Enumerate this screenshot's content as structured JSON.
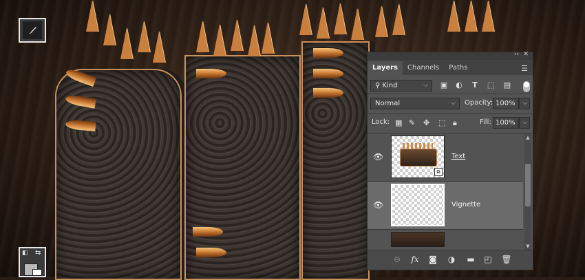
{
  "panel": {
    "title_controls": {
      "collapse": "‹‹",
      "close": "✕"
    },
    "tabs": [
      {
        "label": "Layers",
        "active": true
      },
      {
        "label": "Channels",
        "active": false
      },
      {
        "label": "Paths",
        "active": false
      }
    ],
    "menu_icon": "hamburger-icon",
    "filter": {
      "kind_label": "Kind",
      "icons": [
        "pixel-filter-icon",
        "adjustment-filter-icon",
        "type-filter-icon",
        "shape-filter-icon",
        "smart-object-filter-icon"
      ]
    },
    "blend_mode": "Normal",
    "opacity": {
      "label": "Opacity:",
      "value": "100%"
    },
    "lock": {
      "label": "Lock:",
      "icons": [
        "lock-transparent-icon",
        "lock-pixels-icon",
        "lock-position-icon",
        "lock-artboard-icon",
        "lock-all-icon"
      ]
    },
    "fill": {
      "label": "Fill:",
      "value": "100%"
    },
    "layers": [
      {
        "name": "Text",
        "visible": true,
        "selected": false,
        "smart_object": true
      },
      {
        "name": "Vignette",
        "visible": true,
        "selected": true,
        "smart_object": false
      },
      {
        "name": "",
        "visible": true,
        "selected": false,
        "smart_object": false
      }
    ],
    "footer_icons": [
      "link-layers-icon",
      "fx-icon",
      "add-mask-icon",
      "adjustment-layer-icon",
      "new-group-icon",
      "new-layer-icon",
      "delete-layer-icon"
    ]
  },
  "toolbox": {
    "active_tool": "brush-icon",
    "swap_colors": "swap-colors-icon",
    "default_colors": "default-colors-icon"
  },
  "colors": {
    "panel_bg": "#535353",
    "selected_layer": "#6b6b6b",
    "spike_copper": "#c9803f"
  }
}
